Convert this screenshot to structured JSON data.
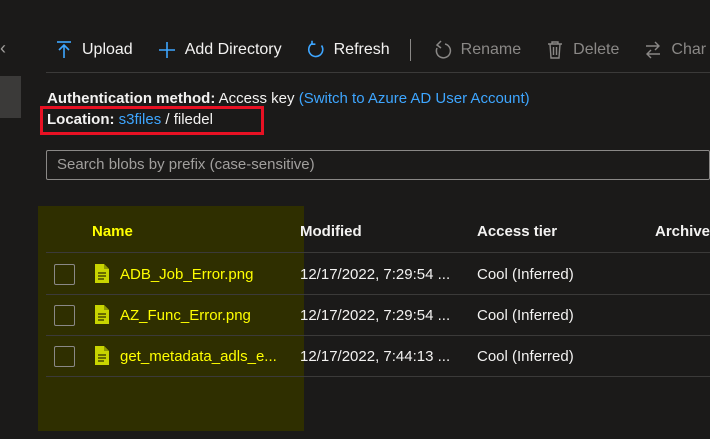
{
  "toolbar": {
    "upload": "Upload",
    "add_directory": "Add Directory",
    "refresh": "Refresh",
    "rename": "Rename",
    "delete": "Delete",
    "change": "Char"
  },
  "auth": {
    "label": "Authentication method:",
    "value": "Access key",
    "switch_link": "(Switch to Azure AD User Account)"
  },
  "location": {
    "label": "Location:",
    "container": "s3files",
    "separator": "/",
    "folder": "filedel"
  },
  "search": {
    "placeholder": "Search blobs by prefix (case-sensitive)"
  },
  "table": {
    "headers": {
      "name": "Name",
      "modified": "Modified",
      "access_tier": "Access tier",
      "archive": "Archive"
    },
    "rows": [
      {
        "name": "ADB_Job_Error.png",
        "modified": "12/17/2022, 7:29:54 ...",
        "access_tier": "Cool (Inferred)"
      },
      {
        "name": "AZ_Func_Error.png",
        "modified": "12/17/2022, 7:29:54 ...",
        "access_tier": "Cool (Inferred)"
      },
      {
        "name": "get_metadata_adls_e...",
        "modified": "12/17/2022, 7:44:13 ...",
        "access_tier": "Cool (Inferred)"
      }
    ]
  },
  "colors": {
    "background": "#1b1a19",
    "link": "#3ea6ff",
    "highlight_text": "#ffff00",
    "highlight_bg": "#2f2f00",
    "red_box": "#e81123",
    "file_icon": "#c8d400"
  }
}
